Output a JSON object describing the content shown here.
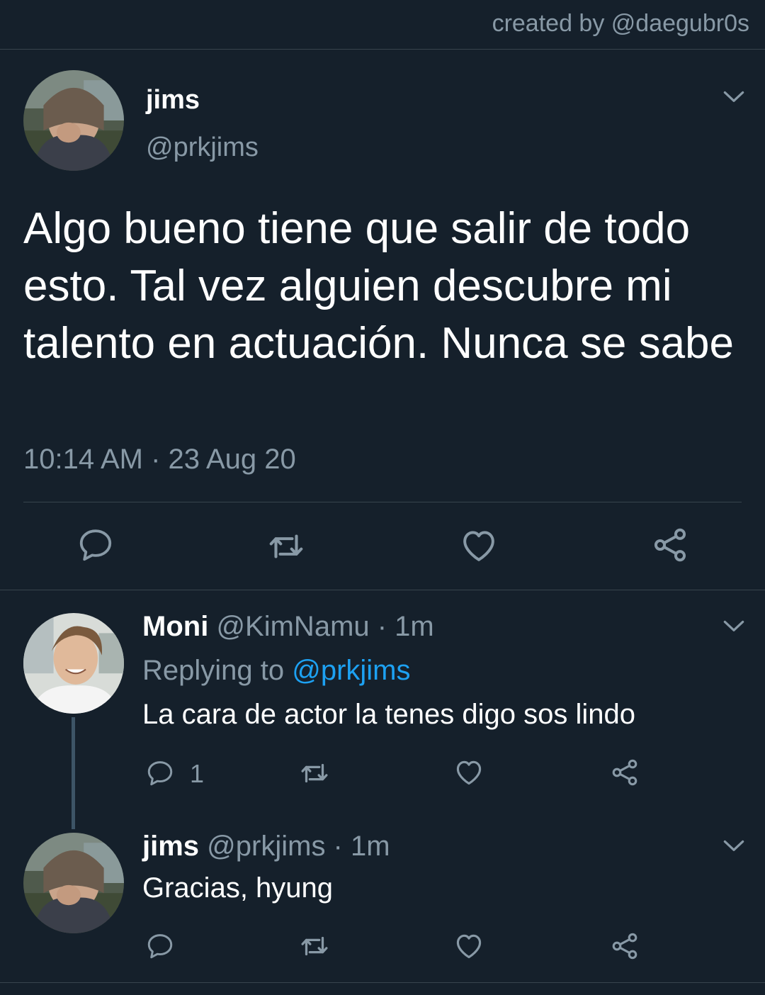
{
  "credit": "created by @daegubr0s",
  "main_tweet": {
    "name": "jims",
    "handle": "@prkjims",
    "text": "Algo bueno tiene que salir de todo esto. Tal vez alguien descubre mi talento en actuación. Nunca se sabe",
    "timestamp": "10:14 AM · 23 Aug 20"
  },
  "replies": [
    {
      "name": "Moni",
      "handle_time": "@KimNamu · 1m",
      "replying_prefix": "Replying to ",
      "replying_to": "@prkjims",
      "text": "La cara de actor la tenes digo sos lindo",
      "reply_count": "1"
    },
    {
      "name": "jims",
      "handle_time": "@prkjims · 1m",
      "text": "Gracias, hyung"
    }
  ],
  "icons": {
    "reply": "reply-icon",
    "retweet": "retweet-icon",
    "like": "heart-icon",
    "share": "share-icon",
    "menu": "chevron-down-icon"
  },
  "colors": {
    "background": "#15202b",
    "secondary_text": "#8899a6",
    "accent": "#1da1f2",
    "divider": "#38444d"
  }
}
